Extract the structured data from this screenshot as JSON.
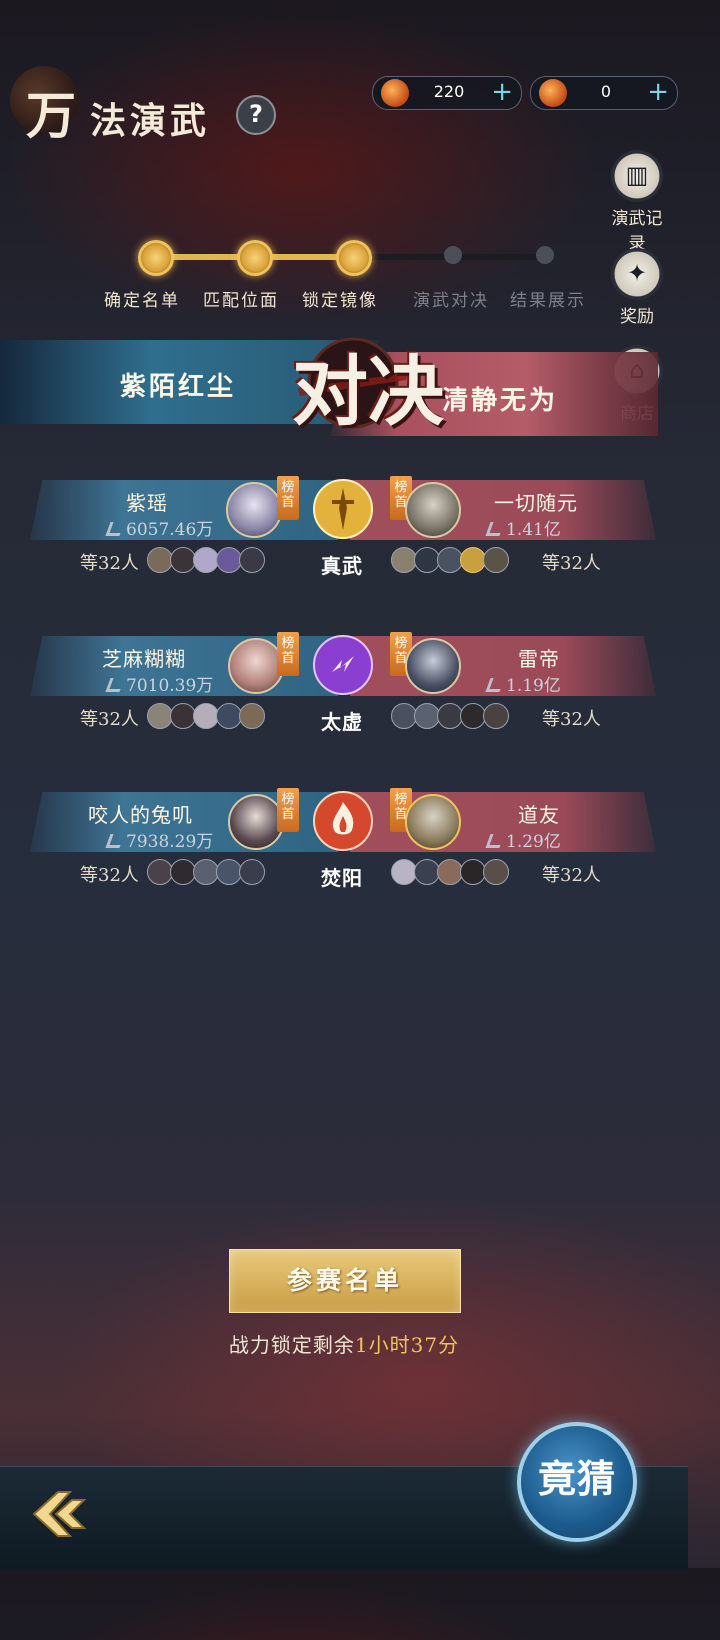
{
  "header": {
    "title_main": "万",
    "title_sub": "法演武",
    "help_label": "?"
  },
  "currency": [
    {
      "icon": "flame-token-icon",
      "value": "220",
      "plus": "+"
    },
    {
      "icon": "flame-token-icon",
      "value": "0",
      "plus": "+"
    }
  ],
  "side_menu": [
    {
      "label": "演武记录",
      "icon": "scroll-icon",
      "glyph": "▥"
    },
    {
      "label": "奖励",
      "icon": "reward-bag-icon",
      "glyph": "✦"
    },
    {
      "label": "商店",
      "icon": "pagoda-shop-icon",
      "glyph": "⌂"
    }
  ],
  "progress": {
    "current_step": 3,
    "steps": [
      "确定名单",
      "匹配位面",
      "锁定镜像",
      "演武对决",
      "结果展示"
    ]
  },
  "versus": {
    "left_faction": "紫陌红尘",
    "right_faction": "清静无为",
    "emblem": "对决"
  },
  "matches": [
    {
      "left_player": "紫瑶",
      "left_power": "6057.46万",
      "right_player": "一切随元",
      "right_power": "1.41亿",
      "sect": "真武",
      "left_count": "等32人",
      "right_count": "等32人",
      "rank_tag": "榜首",
      "sect_color": "#d9a72e"
    },
    {
      "left_player": "芝麻糊糊",
      "left_power": "7010.39万",
      "right_player": "雷帝",
      "right_power": "1.19亿",
      "sect": "太虚",
      "left_count": "等32人",
      "right_count": "等32人",
      "rank_tag": "榜首",
      "sect_color": "#9b4fd6"
    },
    {
      "left_player": "咬人的兔叽",
      "left_power": "7938.29万",
      "right_player": "道友",
      "right_power": "1.29亿",
      "sect": "焚阳",
      "left_count": "等32人",
      "right_count": "等32人",
      "rank_tag": "榜首",
      "sect_color": "#d7503a"
    }
  ],
  "bottom": {
    "entry_list_label": "参赛名单",
    "lock_prefix": "战力锁定剩余",
    "lock_time": "1小时37分",
    "guess_label": "竟猜"
  }
}
